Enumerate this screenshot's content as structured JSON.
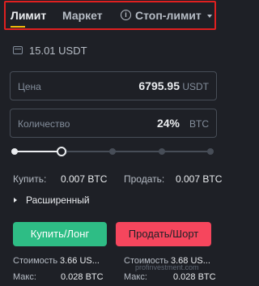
{
  "tabs": {
    "limit": "Лимит",
    "market": "Маркет",
    "stop_limit": "Стоп-лимит",
    "info_glyph": "i"
  },
  "balance": {
    "text": "15.01 USDT"
  },
  "price": {
    "label": "Цена",
    "value": "6795.95",
    "unit": "USDT"
  },
  "quantity": {
    "label": "Количество",
    "value": "24%",
    "unit": "BTC"
  },
  "slider": {
    "percent": 24
  },
  "buy_amount": {
    "label": "Купить:",
    "value": "0.007 BTC"
  },
  "sell_amount": {
    "label": "Продать:",
    "value": "0.007 BTC"
  },
  "advanced": {
    "label": "Расширенный"
  },
  "buttons": {
    "buy": "Купить/Лонг",
    "sell": "Продать/Шорт"
  },
  "cost": {
    "buy_label": "Стоимость",
    "buy_value": "3.66 US...",
    "sell_label": "Стоимость",
    "sell_value": "3.68 US..."
  },
  "max": {
    "buy_label": "Макс:",
    "buy_value": "0.028 BTC",
    "sell_label": "Макс:",
    "sell_value": "0.028 BTC"
  },
  "watermark": "profinvestment.com",
  "colors": {
    "background": "#1e2026",
    "accent": "#f0b90b",
    "buy": "#2ebd85",
    "sell": "#f6465d",
    "highlight_frame": "#e02020"
  }
}
